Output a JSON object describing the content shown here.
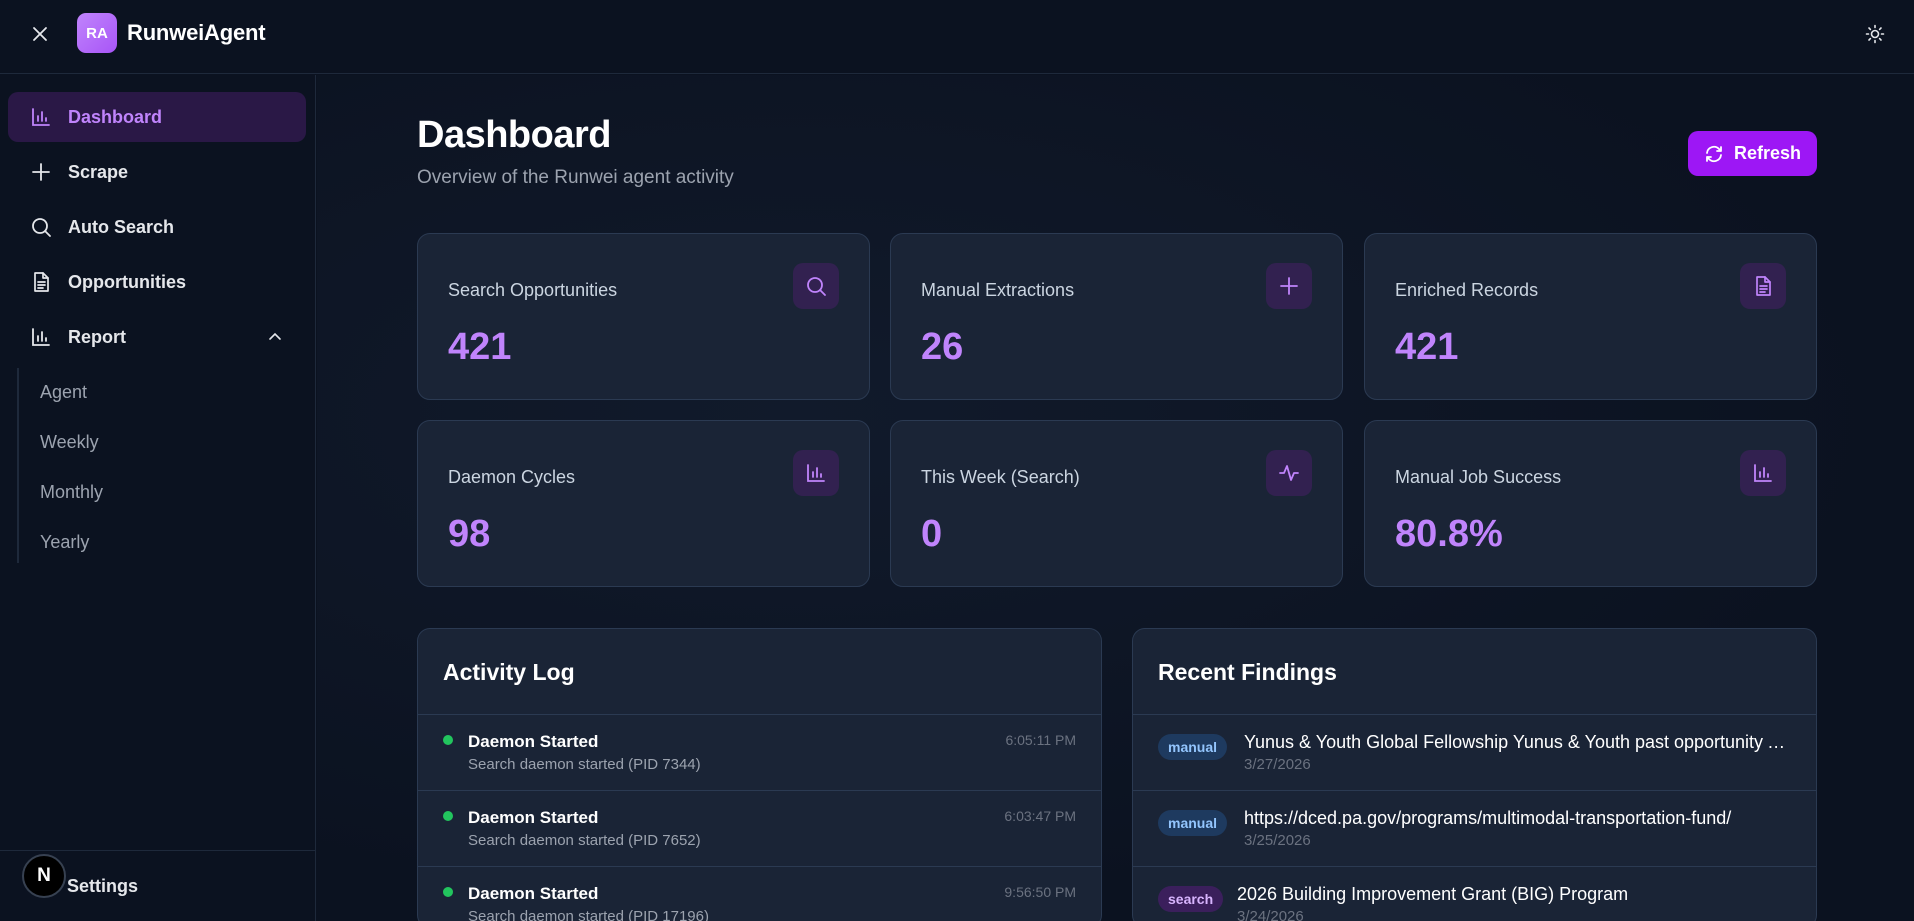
{
  "app": {
    "logo_text": "RA",
    "title": "RunweiAgent"
  },
  "sidebar": {
    "items": [
      {
        "label": "Dashboard",
        "icon": "bar-chart-icon",
        "active": true
      },
      {
        "label": "Scrape",
        "icon": "plus-icon"
      },
      {
        "label": "Auto Search",
        "icon": "search-icon"
      },
      {
        "label": "Opportunities",
        "icon": "document-icon"
      },
      {
        "label": "Report",
        "icon": "bar-chart-icon",
        "expanded": true
      }
    ],
    "report_sub": [
      "Agent",
      "Weekly",
      "Monthly",
      "Yearly"
    ],
    "settings_label": "Settings",
    "n_badge": "N"
  },
  "header": {
    "title": "Dashboard",
    "subtitle": "Overview of the Runwei agent activity",
    "refresh_label": "Refresh"
  },
  "stats": [
    {
      "label": "Search Opportunities",
      "value": "421",
      "icon": "search-icon"
    },
    {
      "label": "Manual Extractions",
      "value": "26",
      "icon": "plus-icon"
    },
    {
      "label": "Enriched Records",
      "value": "421",
      "icon": "document-icon"
    },
    {
      "label": "Daemon Cycles",
      "value": "98",
      "icon": "bar-chart-icon"
    },
    {
      "label": "This Week (Search)",
      "value": "0",
      "icon": "activity-icon"
    },
    {
      "label": "Manual Job Success",
      "value": "80.8%",
      "icon": "bar-chart-icon"
    }
  ],
  "activity": {
    "title": "Activity Log",
    "entries": [
      {
        "title": "Daemon Started",
        "desc": "Search daemon started (PID 7344)",
        "time": "6:05:11 PM"
      },
      {
        "title": "Daemon Started",
        "desc": "Search daemon started (PID 7652)",
        "time": "6:03:47 PM"
      },
      {
        "title": "Daemon Started",
        "desc": "Search daemon started (PID 17196)",
        "time": "9:56:50 PM"
      }
    ]
  },
  "findings": {
    "title": "Recent Findings",
    "entries": [
      {
        "tag": "manual",
        "title": "Yunus & Youth Global Fellowship Yunus & Youth past opportunity Ab...",
        "date": "3/27/2026"
      },
      {
        "tag": "manual",
        "title": "https://dced.pa.gov/programs/multimodal-transportation-fund/",
        "date": "3/25/2026"
      },
      {
        "tag": "search",
        "title": "2026 Building Improvement Grant (BIG) Program",
        "date": "3/24/2026"
      }
    ]
  },
  "colors": {
    "accent": "#c084fc",
    "button": "#9d17f5",
    "status_dot": "#22c55e"
  }
}
